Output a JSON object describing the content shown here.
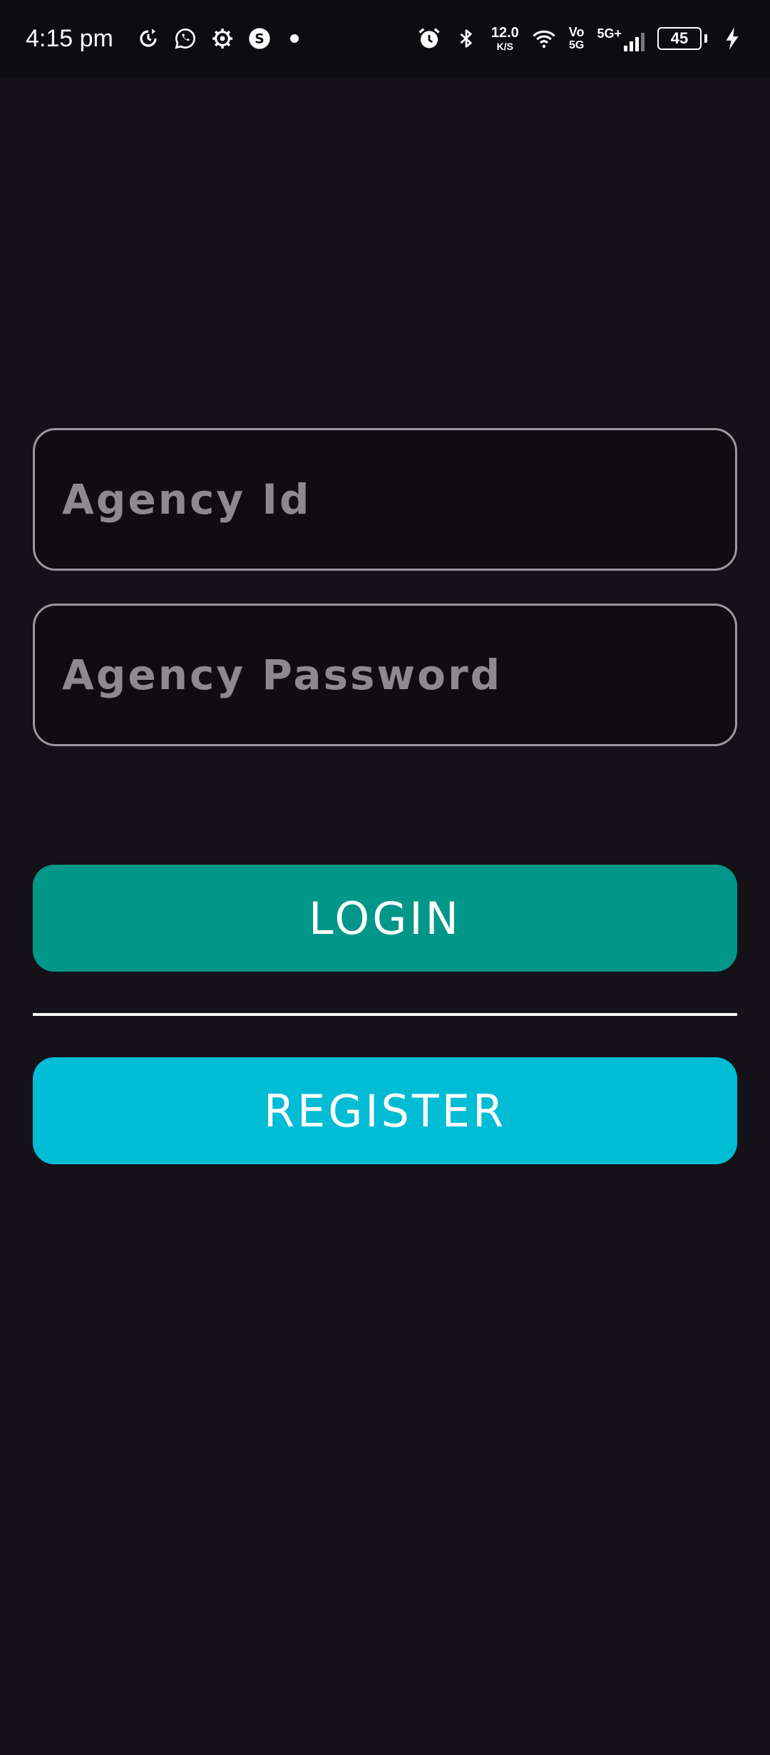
{
  "status_bar": {
    "time": "4:15 pm",
    "net_speed_value": "12.0",
    "net_speed_unit": "K/S",
    "volte_top": "Vo",
    "volte_bottom": "5G",
    "network_type": "5G+",
    "battery_level": "45",
    "icons": [
      "sync-icon",
      "whatsapp-icon",
      "settings-icon",
      "app-s-icon",
      "notification-dot",
      "alarm-icon",
      "bluetooth-icon",
      "wifi-icon",
      "signal-icon",
      "battery-icon",
      "charging-icon"
    ]
  },
  "form": {
    "agency_id_placeholder": "Agency Id",
    "agency_password_placeholder": "Agency Password"
  },
  "buttons": {
    "login_label": "LOGIN",
    "register_label": "REGISTER"
  },
  "colors": {
    "background": "#141119",
    "login": "#009688",
    "register": "#00BCD4"
  }
}
